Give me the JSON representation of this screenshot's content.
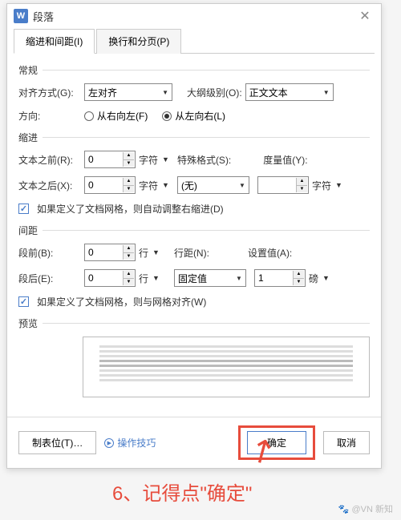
{
  "titlebar": {
    "icon_text": "W",
    "title": "段落"
  },
  "tabs": {
    "indent": "缩进和间距(I)",
    "page": "换行和分页(P)"
  },
  "sections": {
    "general": "常规",
    "indent": "缩进",
    "spacing": "间距",
    "preview": "预览"
  },
  "general": {
    "align_label": "对齐方式(G):",
    "align_value": "左对齐",
    "outline_label": "大纲级别(O):",
    "outline_value": "正文文本",
    "direction_label": "方向:",
    "rtl_label": "从右向左(F)",
    "ltr_label": "从左向右(L)"
  },
  "indent": {
    "before_label": "文本之前(R):",
    "before_value": "0",
    "after_label": "文本之后(X):",
    "after_value": "0",
    "special_label": "特殊格式(S):",
    "special_value": "(无)",
    "measure_label": "度量值(Y):",
    "measure_value": "",
    "unit_char": "字符",
    "grid_check": "如果定义了文档网格，则自动调整右缩进(D)"
  },
  "spacing": {
    "before_label": "段前(B):",
    "before_value": "0",
    "after_label": "段后(E):",
    "after_value": "0",
    "unit_line": "行",
    "linespace_label": "行距(N):",
    "linespace_value": "固定值",
    "setvalue_label": "设置值(A):",
    "setvalue_value": "1",
    "unit_pt": "磅",
    "grid_check": "如果定义了文档网格，则与网格对齐(W)"
  },
  "footer": {
    "tabstops": "制表位(T)…",
    "tips": "操作技巧",
    "ok": "确定",
    "cancel": "取消"
  },
  "annotation": "6、记得点\"确定\"",
  "watermark": "🐾 @VN 新知"
}
